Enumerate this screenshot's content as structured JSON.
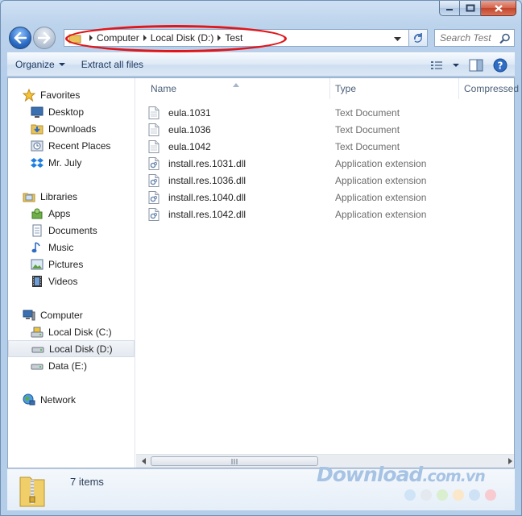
{
  "window": {
    "caption_buttons": [
      "minimize",
      "maximize",
      "close"
    ]
  },
  "address_bar": {
    "crumbs": [
      "Computer",
      "Local Disk (D:)",
      "Test"
    ]
  },
  "search": {
    "placeholder": "Search Test"
  },
  "toolbar": {
    "organize_label": "Organize",
    "extract_label": "Extract all files"
  },
  "nav_pane": {
    "favorites": {
      "label": "Favorites",
      "items": [
        "Desktop",
        "Downloads",
        "Recent Places",
        "Mr. July"
      ]
    },
    "libraries": {
      "label": "Libraries",
      "items": [
        "Apps",
        "Documents",
        "Music",
        "Pictures",
        "Videos"
      ]
    },
    "computer": {
      "label": "Computer",
      "items": [
        "Local Disk (C:)",
        "Local Disk (D:)",
        "Data (E:)"
      ],
      "selected": "Local Disk (D:)"
    },
    "network": {
      "label": "Network"
    }
  },
  "columns": {
    "name": "Name",
    "type": "Type",
    "compressed": "Compressed"
  },
  "files": [
    {
      "name": "eula.1031",
      "type": "Text Document",
      "icon": "text-file-icon"
    },
    {
      "name": "eula.1036",
      "type": "Text Document",
      "icon": "text-file-icon"
    },
    {
      "name": "eula.1042",
      "type": "Text Document",
      "icon": "text-file-icon"
    },
    {
      "name": "install.res.1031.dll",
      "type": "Application extension",
      "icon": "dll-file-icon"
    },
    {
      "name": "install.res.1036.dll",
      "type": "Application extension",
      "icon": "dll-file-icon"
    },
    {
      "name": "install.res.1040.dll",
      "type": "Application extension",
      "icon": "dll-file-icon"
    },
    {
      "name": "install.res.1042.dll",
      "type": "Application extension",
      "icon": "dll-file-icon"
    }
  ],
  "details_pane": {
    "item_count": "7 items"
  },
  "watermark": {
    "text": "Download",
    "domain": ".com.vn"
  },
  "colors": {
    "annotation": "#e0161b",
    "selection": "#e4e9f0",
    "watermark": "#a7c3e4",
    "dots": [
      "#cfe4f7",
      "#e3e9ee",
      "#d9efcf",
      "#fbe7c9",
      "#cfe1f5",
      "#f8cbd0"
    ]
  }
}
